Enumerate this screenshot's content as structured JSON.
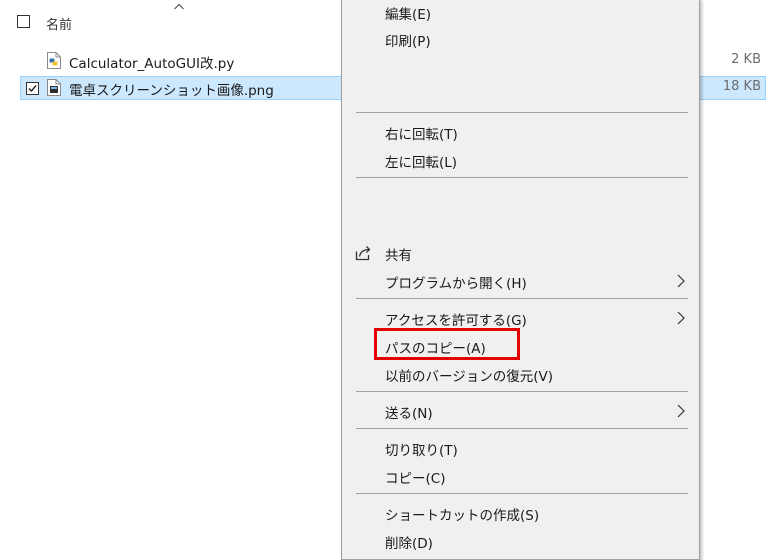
{
  "explorer": {
    "column_name": "名前",
    "files": [
      {
        "name": "Calculator_AutoGUI改.py",
        "size": "2 KB",
        "checked": false
      },
      {
        "name": "電卓スクリーンショット画像.png",
        "size": "18 KB",
        "checked": true
      }
    ]
  },
  "context_menu": {
    "items": [
      {
        "label": "編集(E)"
      },
      {
        "label": "印刷(P)"
      },
      {
        "label": "右に回転(T)"
      },
      {
        "label": "左に回転(L)"
      },
      {
        "label": "共有",
        "icon": "share-icon"
      },
      {
        "label": "プログラムから開く(H)",
        "submenu": true
      },
      {
        "label": "アクセスを許可する(G)",
        "submenu": true
      },
      {
        "label": "パスのコピー(A)",
        "highlighted": true
      },
      {
        "label": "以前のバージョンの復元(V)"
      },
      {
        "label": "送る(N)",
        "submenu": true
      },
      {
        "label": "切り取り(T)"
      },
      {
        "label": "コピー(C)"
      },
      {
        "label": "ショートカットの作成(S)"
      },
      {
        "label": "削除(D)"
      }
    ]
  },
  "colors": {
    "selection_bg": "#cce8ff",
    "selection_border": "#99d1ff",
    "menu_bg": "#f0f0f0",
    "highlight_border": "#e60000"
  }
}
